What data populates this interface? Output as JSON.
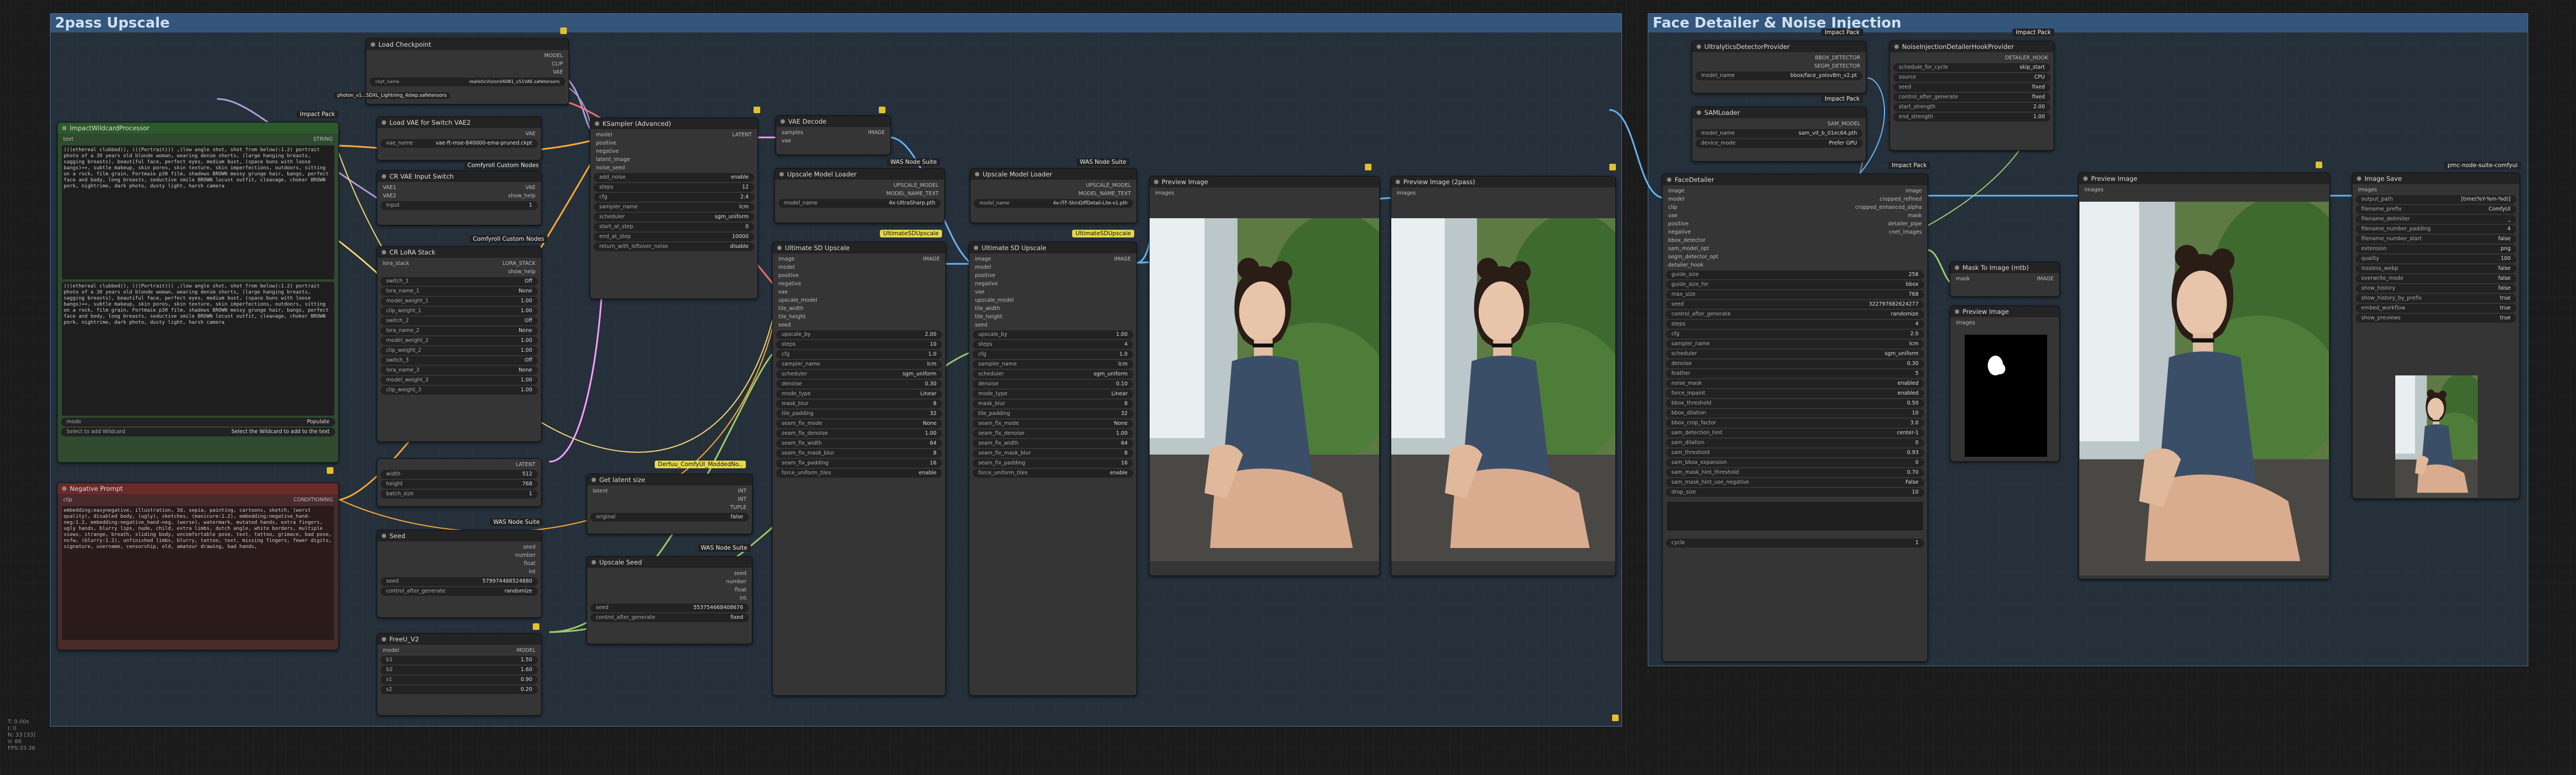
{
  "groups": {
    "g1": "2pass Upscale",
    "g2": "Face Detailer & Noise Injection"
  },
  "badges": {
    "impact": "Impact Pack",
    "was": "WAS Node Suite",
    "ccn": "Comfyroll Custom Nodes",
    "usd": "UltimateSDUpscale",
    "derfuu": "Derfuu_ComfyUI_ModdedNo..",
    "pmc": "pmc-node-suite-comfyui"
  },
  "wildcard": {
    "title": "ImpactWildcardProcessor",
    "label": "text",
    "out": "STRING",
    "text1": "(((ethereal clubbed)), (((Portrait))) ,(low angle shot, shot from below):1.2) portrait photo of a 30 years old blonde woman, wearing denim shorts, (large hanging breasts, sagging breasts), beautiful face, perfect eyes, medium bust, (space buns with loose bangs)++, subtle makeup, skin pores, skin texture, skin imperfections, outdoors, sitting on a rock, film grain, Fortmaie p30 film, shadows BROWN messy grunge hair, bangs, perfect face and body, long breasts, seductive smile BROWN locust outfit, cleavage, choker BROWN pork, nightrime, dark photo, dusty light, harsh camera",
    "text2": "(((ethereal clubbed)), (((Portrait))) ,(low angle shot, shot from below):1.2) portrait photo of a 30 years old blonde woman, wearing denim shorts, (large hanging breasts, sagging breasts), beautiful face, perfect eyes, medium bust, (space buns with loose bangs)++, subtle makeup, skin pores, skin texture, skin imperfections, outdoors, sitting on a rock, film grain, Fortmaie p30 film, shadows BROWN messy grunge hair, bangs, perfect face and body, long breasts, seductive smile BROWN locust outfit, cleavage, choker BROWN pork, nightrime, dark photo, dusty light, harsh camera",
    "mode_l": "mode",
    "mode_v": "Populate",
    "sel_l": "Select to add Wildcard",
    "sel_v": "Select the Wildcard to add to the text"
  },
  "neg": {
    "title": "Negative Prompt",
    "in": "clip",
    "out": "CONDITIONING",
    "text": "embedding:easynegative, illustration, 3d, sepia, painting, cartoons, sketch, (worst quality), disabled body, (ugly), sketches, (manicure:1.2), embedding:negative_hand-neg:1.2, embedding:negative_hand-neg, (worse), watermark, mutated hands, extra fingers, ugly hands, blurry lips, nude, child, extra limbs, dutch angle, white borders, multiple views, strange, breath, sliding body, uncomfortable pose, text, tattoo, grimace, bad pose, nsfw, (blurry:1.2), unfinished limbs, blurry, tattoo, text, missing fingers, fewer digits, signature, username, censorship, old, amateur drawing, bad hands,"
  },
  "ckpt": {
    "title": "Load Checkpoint",
    "o1": "MODEL",
    "o2": "CLIP",
    "o3": "VAE",
    "name_l": "ckpt_name",
    "name_v": "realisticVisionV60B1_v51VAE.safetensors",
    "w2": "photon_v1...SDXL_Lightning_4step.safetensors"
  },
  "vae2": {
    "title": "Load VAE for Switch VAE2",
    "o1": "VAE",
    "name_l": "vae_name",
    "name_v": "vae-ft-mse-840000-ema-pruned.ckpt"
  },
  "vsw": {
    "title": "CR VAE Input Switch",
    "i1": "VAE1",
    "i2": "VAE2",
    "o1": "VAE",
    "o2": "show_help",
    "w_l": "Input",
    "w_v": "1"
  },
  "lora": {
    "title": "CR LoRA Stack",
    "i1": "lora_stack",
    "o1": "LORA_STACK",
    "o2": "show_help",
    "rows": [
      [
        "switch_1",
        "Off"
      ],
      [
        "lora_name_1",
        "None"
      ],
      [
        "model_weight_1",
        "1.00"
      ],
      [
        "clip_weight_1",
        "1.00"
      ],
      [
        "switch_2",
        "Off"
      ],
      [
        "lora_name_2",
        "None"
      ],
      [
        "model_weight_2",
        "1.00"
      ],
      [
        "clip_weight_2",
        "1.00"
      ],
      [
        "switch_3",
        "Off"
      ],
      [
        "lora_name_3",
        "None"
      ],
      [
        "model_weight_3",
        "1.00"
      ],
      [
        "clip_weight_3",
        "1.00"
      ]
    ]
  },
  "latent": {
    "o1": "LATENT",
    "rows": [
      [
        "width",
        "512"
      ],
      [
        "height",
        "768"
      ],
      [
        "batch_size",
        "1"
      ]
    ]
  },
  "seed1": {
    "title": "Seed",
    "o": [
      "seed",
      "number",
      "float",
      "int"
    ],
    "rows": [
      [
        "seed",
        "579974488524880"
      ],
      [
        "control_after_generate",
        "randomize"
      ]
    ]
  },
  "freeu": {
    "title": "FreeU_V2",
    "i1": "model",
    "o1": "MODEL",
    "rows": [
      [
        "b1",
        "1.50"
      ],
      [
        "b2",
        "1.60"
      ],
      [
        "s1",
        "0.90"
      ],
      [
        "s2",
        "0.20"
      ]
    ]
  },
  "ksamp": {
    "title": "KSampler (Advanced)",
    "ins": [
      "model",
      "positive",
      "negative",
      "latent_image",
      "noise_seed"
    ],
    "o1": "LATENT",
    "rows": [
      [
        "add_noise",
        "enable"
      ],
      [
        "steps",
        "12"
      ],
      [
        "cfg",
        "2.4"
      ],
      [
        "sampler_name",
        "lcm"
      ],
      [
        "scheduler",
        "sgm_uniform"
      ],
      [
        "start_at_step",
        "0"
      ],
      [
        "end_at_step",
        "10000"
      ],
      [
        "return_with_leftover_noise",
        "disable"
      ]
    ]
  },
  "vaed": {
    "title": "VAE Decode",
    "i1": "samples",
    "i2": "vae",
    "o1": "IMAGE"
  },
  "gls": {
    "title": "Get latent size",
    "i1": "latent",
    "o1": "INT",
    "o2": "INT",
    "o3": "TUPLE",
    "w_l": "original",
    "w_v": "false"
  },
  "useed": {
    "title": "Upscale Seed",
    "o": [
      "seed",
      "number",
      "float",
      "int"
    ],
    "rows": [
      [
        "seed",
        "553754668408676"
      ],
      [
        "control_after_generate",
        "fixed"
      ]
    ]
  },
  "uml1": {
    "title": "Upscale Model Loader",
    "o1": "UPSCALE_MODEL",
    "o2": "MODEL_NAME_TEXT",
    "w_l": "model_name",
    "w_v": "4x-UltraSharp.pth"
  },
  "uml2": {
    "title": "Upscale Model Loader",
    "o1": "UPSCALE_MODEL",
    "o2": "MODEL_NAME_TEXT",
    "w_l": "model_name",
    "w_v": "4x-ITF-SkinDiffDetail-Lite-v1.pth"
  },
  "usdu_ins": [
    "image",
    "model",
    "positive",
    "negative",
    "vae",
    "upscale_model",
    "tile_width",
    "tile_height",
    "seed"
  ],
  "usdu1": {
    "title": "Ultimate SD Upscale",
    "o1": "IMAGE",
    "rows": [
      [
        "upscale_by",
        "2.00"
      ],
      [
        "steps",
        "10"
      ],
      [
        "cfg",
        "1.0"
      ],
      [
        "sampler_name",
        "lcm"
      ],
      [
        "scheduler",
        "sgm_uniform"
      ],
      [
        "denoise",
        "0.30"
      ],
      [
        "mode_type",
        "Linear"
      ],
      [
        "mask_blur",
        "8"
      ],
      [
        "tile_padding",
        "32"
      ],
      [
        "seam_fix_mode",
        "None"
      ],
      [
        "seam_fix_denoise",
        "1.00"
      ],
      [
        "seam_fix_width",
        "64"
      ],
      [
        "seam_fix_mask_blur",
        "8"
      ],
      [
        "seam_fix_padding",
        "16"
      ],
      [
        "force_uniform_tiles",
        "enable"
      ]
    ]
  },
  "usdu2": {
    "title": "Ultimate SD Upscale",
    "o1": "IMAGE",
    "rows": [
      [
        "upscale_by",
        "1.00"
      ],
      [
        "steps",
        "4"
      ],
      [
        "cfg",
        "1.0"
      ],
      [
        "sampler_name",
        "lcm"
      ],
      [
        "scheduler",
        "sgm_uniform"
      ],
      [
        "denoise",
        "0.10"
      ],
      [
        "mode_type",
        "Linear"
      ],
      [
        "mask_blur",
        "8"
      ],
      [
        "tile_padding",
        "32"
      ],
      [
        "seam_fix_mode",
        "None"
      ],
      [
        "seam_fix_denoise",
        "1.00"
      ],
      [
        "seam_fix_width",
        "64"
      ],
      [
        "seam_fix_mask_blur",
        "8"
      ],
      [
        "seam_fix_padding",
        "16"
      ],
      [
        "force_uniform_tiles",
        "enable"
      ]
    ]
  },
  "prev1": {
    "title": "Preview Image",
    "i1": "images"
  },
  "prev2": {
    "title": "Preview Image (2pass)",
    "i1": "images"
  },
  "ultra": {
    "title": "UltralyticsDetectorProvider",
    "o1": "BBOX_DETECTOR",
    "o2": "SEGM_DETECTOR",
    "w_l": "model_name",
    "w_v": "bbox/face_yolov8m_v2.pt"
  },
  "noise": {
    "title": "NoiseInjectionDetailerHookProvider",
    "o1": "DETAILER_HOOK",
    "rows": [
      [
        "schedule_for_cycle",
        "skip_start"
      ],
      [
        "source",
        "CPU"
      ],
      [
        "seed",
        "fixed"
      ],
      [
        "control_after_generate",
        "fixed"
      ],
      [
        "start_strength",
        "2.00"
      ],
      [
        "end_strength",
        "1.00"
      ]
    ]
  },
  "sam": {
    "title": "SAMLoader",
    "o1": "SAM_MODEL",
    "rows": [
      [
        "model_name",
        "sam_vit_b_01ec64.pth"
      ],
      [
        "device_mode",
        "Prefer GPU"
      ]
    ]
  },
  "fd": {
    "title": "FaceDetailer",
    "ins": [
      "image",
      "model",
      "clip",
      "vae",
      "positive",
      "negative",
      "bbox_detector",
      "sam_model_opt",
      "segm_detector_opt",
      "detailer_hook"
    ],
    "outs": [
      "image",
      "cropped_refined",
      "cropped_enhanced_alpha",
      "mask",
      "detailer_pipe",
      "cnet_images"
    ],
    "rows": [
      [
        "guide_size",
        "256"
      ],
      [
        "guide_size_for",
        "bbox"
      ],
      [
        "max_size",
        "768"
      ],
      [
        "seed",
        "322797682624277"
      ],
      [
        "control_after_generate",
        "randomize"
      ],
      [
        "steps",
        "4"
      ],
      [
        "cfg",
        "2.0"
      ],
      [
        "sampler_name",
        "lcm"
      ],
      [
        "scheduler",
        "sgm_uniform"
      ],
      [
        "denoise",
        "0.30"
      ],
      [
        "feather",
        "5"
      ],
      [
        "noise_mask",
        "enabled"
      ],
      [
        "force_inpaint",
        "enabled"
      ],
      [
        "bbox_threshold",
        "0.50"
      ],
      [
        "bbox_dilation",
        "10"
      ],
      [
        "bbox_crop_factor",
        "3.0"
      ],
      [
        "sam_detection_hint",
        "center-1"
      ],
      [
        "sam_dilation",
        "0"
      ],
      [
        "sam_threshold",
        "0.93"
      ],
      [
        "sam_bbox_expansion",
        "0"
      ],
      [
        "sam_mask_hint_threshold",
        "0.70"
      ],
      [
        "sam_mask_hint_use_negative",
        "False"
      ],
      [
        "drop_size",
        "10"
      ]
    ],
    "wild": "wildcard",
    "cycle_l": "cycle",
    "cycle_v": "1"
  },
  "m2i": {
    "title": "Mask To Image (mtb)",
    "i1": "mask",
    "o1": "IMAGE"
  },
  "prev3": {
    "title": "Preview Image",
    "i1": "images"
  },
  "prev4": {
    "title": "Preview Image",
    "i1": "images"
  },
  "isave": {
    "title": "Image Save",
    "i1": "images",
    "rows": [
      [
        "output_path",
        "[time(%Y-%m-%d)]"
      ],
      [
        "filename_prefix",
        "ComfyUI"
      ],
      [
        "filename_delimiter",
        "_"
      ],
      [
        "filename_number_padding",
        "4"
      ],
      [
        "filename_number_start",
        "false"
      ],
      [
        "extension",
        "png"
      ],
      [
        "quality",
        "100"
      ],
      [
        "lossless_webp",
        "false"
      ],
      [
        "overwrite_mode",
        "false"
      ],
      [
        "show_history",
        "false"
      ],
      [
        "show_history_by_prefix",
        "true"
      ],
      [
        "embed_workflow",
        "true"
      ],
      [
        "show_previews",
        "true"
      ]
    ]
  },
  "stats": [
    "T: 0.00s",
    "I: 0",
    "N: 33 [33]",
    "V: 66",
    "FPS:33.36"
  ],
  "colors": {
    "link_model": "#b39ddb",
    "link_clip": "#f5d76e",
    "link_vae": "#ff6e6e",
    "link_image": "#64b5f6",
    "link_cond": "#ffa931",
    "link_latent": "#ff9cf9",
    "link_int": "#9ccc65"
  }
}
